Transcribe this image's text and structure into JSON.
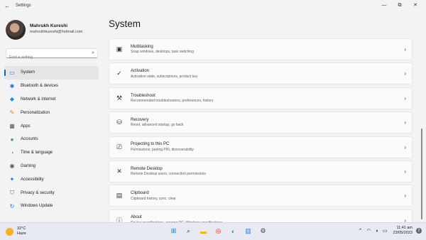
{
  "window": {
    "title": "Settings",
    "back_icon": "←",
    "minimize": "—",
    "maximize": "⧉",
    "close": "✕"
  },
  "profile": {
    "name": "Mahrukh Kureshi",
    "email": "mahrukhkureshi@hotmail.com"
  },
  "search": {
    "placeholder": "Find a setting"
  },
  "sidebar": {
    "items": [
      {
        "label": "System",
        "icon": "system-icon",
        "glyph": "▭",
        "color": "#0067c0"
      },
      {
        "label": "Bluetooth & devices",
        "icon": "bluetooth-icon",
        "glyph": "✱",
        "color": "#0a74d6"
      },
      {
        "label": "Network & internet",
        "icon": "network-icon",
        "glyph": "◆",
        "color": "#1c8ee8"
      },
      {
        "label": "Personalization",
        "icon": "personalization-icon",
        "glyph": "✎",
        "color": "#e3832c"
      },
      {
        "label": "Apps",
        "icon": "apps-icon",
        "glyph": "▦",
        "color": "#4f5a6a"
      },
      {
        "label": "Accounts",
        "icon": "accounts-icon",
        "glyph": "●",
        "color": "#2b9c59"
      },
      {
        "label": "Time & language",
        "icon": "time-language-icon",
        "glyph": "◔",
        "color": "#1a7fd1"
      },
      {
        "label": "Gaming",
        "icon": "gaming-icon",
        "glyph": "◉",
        "color": "#555"
      },
      {
        "label": "Accessibility",
        "icon": "accessibility-icon",
        "glyph": "✦",
        "color": "#1768b8"
      },
      {
        "label": "Privacy & security",
        "icon": "shield-icon",
        "glyph": "⛉",
        "color": "#5b6472"
      },
      {
        "label": "Windows Update",
        "icon": "windows-update-icon",
        "glyph": "↻",
        "color": "#0a74d6"
      }
    ],
    "active_index": 0
  },
  "main": {
    "title": "System",
    "cards": [
      {
        "title": "Multitasking",
        "desc": "Snap windows, desktops, task switching",
        "icon": "multitasking-icon",
        "glyph": "▣"
      },
      {
        "title": "Activation",
        "desc": "Activation state, subscriptions, product key",
        "icon": "activation-icon",
        "glyph": "✓"
      },
      {
        "title": "Troubleshoot",
        "desc": "Recommended troubleshooters, preferences, history",
        "icon": "wrench-icon",
        "glyph": "⚒"
      },
      {
        "title": "Recovery",
        "desc": "Reset, advanced startup, go back",
        "icon": "recovery-icon",
        "glyph": "⛁"
      },
      {
        "title": "Projecting to this PC",
        "desc": "Permissions, pairing PIN, discoverability",
        "icon": "projecting-icon",
        "glyph": "⎚"
      },
      {
        "title": "Remote Desktop",
        "desc": "Remote Desktop users, connection permissions",
        "icon": "remote-desktop-icon",
        "glyph": "✕"
      },
      {
        "title": "Clipboard",
        "desc": "Clipboard history, sync, clear",
        "icon": "clipboard-icon",
        "glyph": "▤"
      },
      {
        "title": "About",
        "desc": "Device specifications, rename PC, Windows specifications",
        "icon": "about-icon",
        "glyph": "ⓘ"
      }
    ]
  },
  "taskbar": {
    "weather_temp": "32°C",
    "weather_desc": "Haze",
    "time": "11:41 am",
    "date": "23/05/2023",
    "notifications": "2",
    "apps": [
      {
        "name": "start-icon",
        "glyph": "⊞",
        "color": "#0078d4"
      },
      {
        "name": "search-taskbar-icon",
        "glyph": "⌕",
        "color": "#333"
      },
      {
        "name": "file-explorer-icon",
        "glyph": "▬",
        "color": "#f2b400"
      },
      {
        "name": "chrome-icon",
        "glyph": "◎",
        "color": "#d93025"
      },
      {
        "name": "edge-icon",
        "glyph": "◐",
        "color": "#1591d0"
      },
      {
        "name": "store-icon",
        "glyph": "▥",
        "color": "#3c7ad6"
      },
      {
        "name": "settings-taskbar-icon",
        "glyph": "⚙",
        "color": "#444"
      }
    ]
  }
}
